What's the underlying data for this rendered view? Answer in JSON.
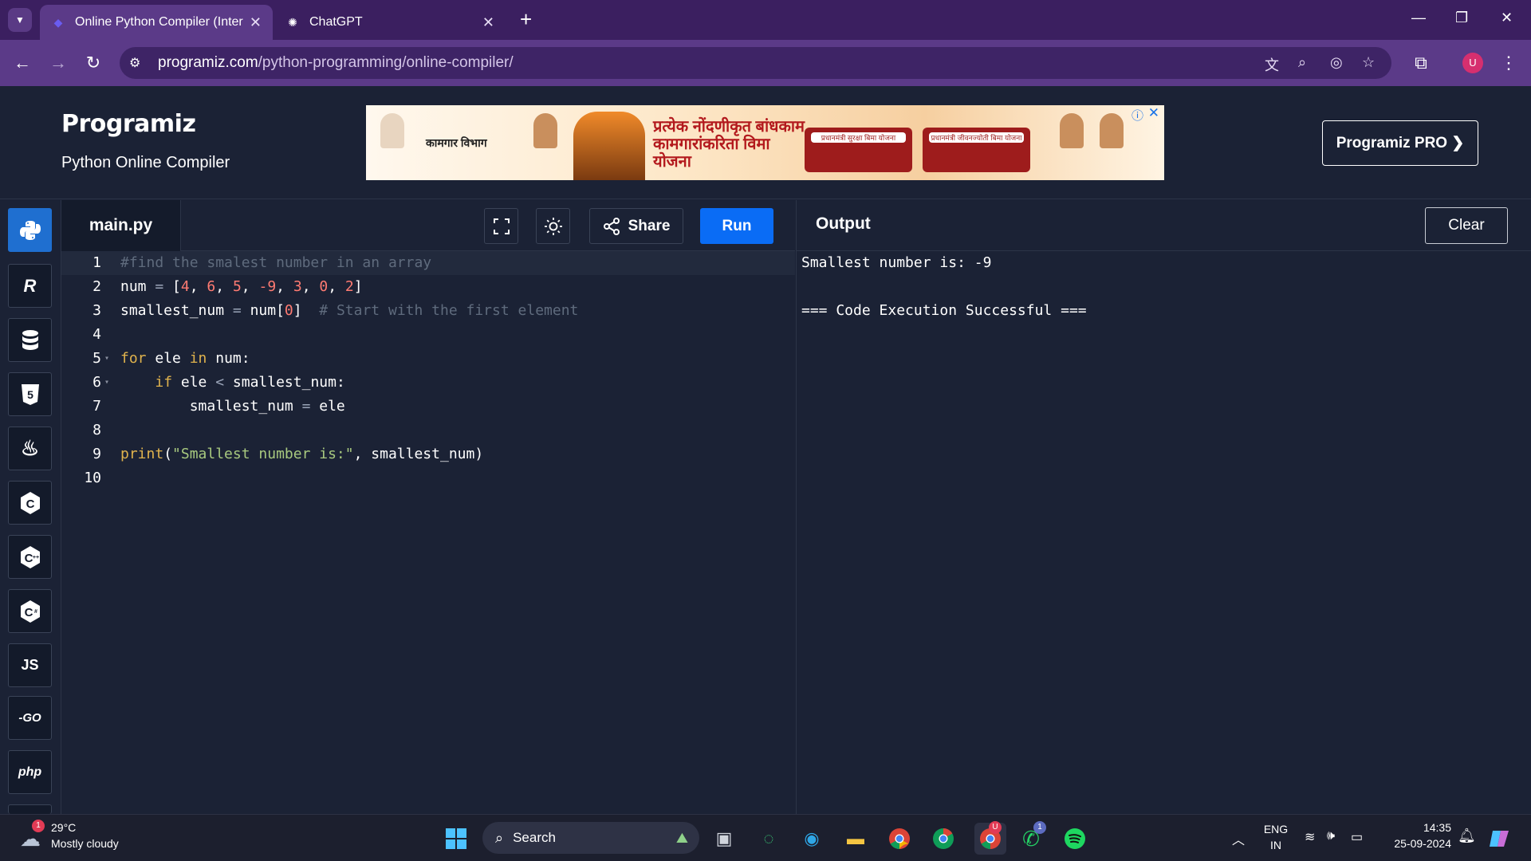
{
  "browser": {
    "tabs": [
      {
        "title": "Online Python Compiler (Interp",
        "active": true
      },
      {
        "title": "ChatGPT",
        "active": false
      }
    ],
    "url_host": "programiz.com",
    "url_path": "/python-programming/online-compiler/"
  },
  "header": {
    "logo": "Programiz",
    "subtitle": "Python Online Compiler",
    "pro_button": "Programiz PRO ❯"
  },
  "ad": {
    "headline": "प्रत्येक नोंदणीकृत बांधकाम कामगारांकरिता विमा योजना",
    "department": "कामगार विभाग",
    "box1": "प्रधानमंत्री सुरक्षा बिमा योजना",
    "box2": "प्रधानमंत्री जीवनज्योती बिमा योजना"
  },
  "sidebar": {
    "languages": [
      {
        "name": "Python",
        "glyph": "",
        "active": true
      },
      {
        "name": "R",
        "glyph": "R",
        "active": false
      },
      {
        "name": "SQL",
        "glyph": "",
        "active": false
      },
      {
        "name": "HTML",
        "glyph": "5",
        "active": false
      },
      {
        "name": "Java",
        "glyph": "♨",
        "active": false
      },
      {
        "name": "C",
        "glyph": "C",
        "active": false
      },
      {
        "name": "C++",
        "glyph": "C",
        "active": false
      },
      {
        "name": "C#",
        "glyph": "C",
        "active": false
      },
      {
        "name": "JavaScript",
        "glyph": "JS",
        "active": false
      },
      {
        "name": "Go",
        "glyph": "-GO",
        "active": false
      },
      {
        "name": "PHP",
        "glyph": "php",
        "active": false
      }
    ]
  },
  "editor": {
    "filename": "main.py",
    "share_label": "Share",
    "run_label": "Run",
    "line_numbers": [
      "1",
      "2",
      "3",
      "4",
      "5",
      "6",
      "7",
      "8",
      "9",
      "10"
    ]
  },
  "output": {
    "title": "Output",
    "clear_label": "Clear",
    "lines": [
      "Smallest number is: -9",
      "",
      "=== Code Execution Successful ==="
    ]
  },
  "taskbar": {
    "weather_temp": "29°C",
    "weather_desc": "Mostly cloudy",
    "weather_badge": "1",
    "search_label": "Search",
    "lang_top": "ENG",
    "lang_bottom": "IN",
    "time": "14:35",
    "date": "25-09-2024",
    "whatsapp_badge": "1",
    "chrome_badge": "U"
  },
  "profile_initial": "U"
}
